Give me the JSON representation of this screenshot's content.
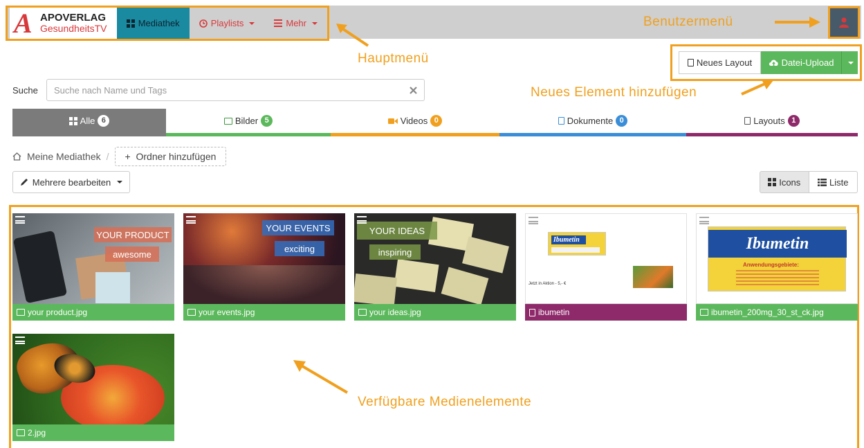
{
  "header": {
    "logo_line1": "APOVERLAG",
    "logo_line2": "GesundheitsTV",
    "logo_mark": "A",
    "nav": [
      {
        "label": "Mediathek",
        "icon": "grid-icon",
        "active": true
      },
      {
        "label": "Playlists",
        "icon": "clock-icon",
        "dropdown": true
      },
      {
        "label": "Mehr",
        "icon": "list-icon",
        "dropdown": true
      }
    ],
    "user_icon": "user-icon"
  },
  "annotations": {
    "hauptmenu": "Hauptmenü",
    "benutzermenu": "Benutzermenü",
    "neues_element": "Neues Element hinzufügen",
    "medienelemente": "Verfügbare Medienelemente"
  },
  "actions": {
    "new_layout": "Neues Layout",
    "upload": "Datei-Upload"
  },
  "search": {
    "label": "Suche",
    "placeholder": "Suche nach Name und Tags"
  },
  "tabs": [
    {
      "label": "Alle",
      "count": "6",
      "color": "#7b7b7b",
      "badge_color": "#ffffff"
    },
    {
      "label": "Bilder",
      "count": "5",
      "color": "#5cb85c",
      "badge_color": "#5cb85c"
    },
    {
      "label": "Videos",
      "count": "0",
      "color": "#f0a01e",
      "badge_color": "#f0a01e"
    },
    {
      "label": "Dokumente",
      "count": "0",
      "color": "#3a8ed8",
      "badge_color": "#3a8ed8"
    },
    {
      "label": "Layouts",
      "count": "1",
      "color": "#8e2a6a",
      "badge_color": "#8e2a6a"
    }
  ],
  "breadcrumb": {
    "home": "Meine Mediathek",
    "separator": "/",
    "add_folder": "Ordner hinzufügen"
  },
  "toolbar": {
    "multi_edit": "Mehrere bearbeiten",
    "view_icons": "Icons",
    "view_list": "Liste"
  },
  "media": [
    {
      "name": "your product.jpg",
      "type": "image",
      "line1": "YOUR PRODUCT",
      "line2": "awesome"
    },
    {
      "name": "your events.jpg",
      "type": "image",
      "line1": "YOUR EVENTS",
      "line2": "exciting"
    },
    {
      "name": "your ideas.jpg",
      "type": "image",
      "line1": "YOUR IDEAS",
      "line2": "inspiring"
    },
    {
      "name": "ibumetin",
      "type": "layout",
      "brand": "Ibumetin",
      "promo": "Jetzt in Aktion - 5,- €"
    },
    {
      "name": "ibumetin_200mg_30_st_ck.jpg",
      "type": "image",
      "brand": "Ibumetin",
      "sub": "Anwendungsgebiete:"
    },
    {
      "name": "2.jpg",
      "type": "image"
    }
  ],
  "colors": {
    "accent": "#f0a01e",
    "image_caption": "#5cb85c",
    "layout_caption": "#8e2a6a",
    "brand_red": "#d8383a",
    "nav_active": "#1a8aa0"
  }
}
